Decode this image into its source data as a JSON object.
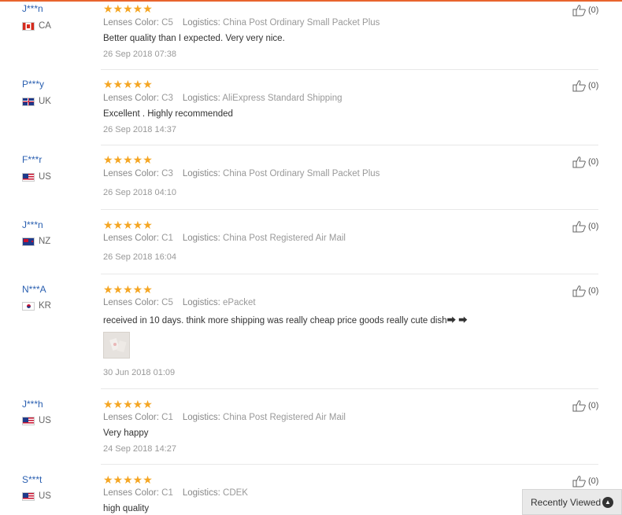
{
  "reviews": [
    {
      "name": "J***n",
      "country": "CA",
      "stars": "★★★★★",
      "color_key": "Lenses Color:",
      "color_val": "C5",
      "log_key": "Logistics:",
      "log_val": "China Post Ordinary Small Packet Plus",
      "text": "Better quality than I expected. Very very nice.",
      "date": "26 Sep 2018 07:38",
      "helpful": "(0)"
    },
    {
      "name": "P***y",
      "country": "UK",
      "stars": "★★★★★",
      "color_key": "Lenses Color:",
      "color_val": "C3",
      "log_key": "Logistics:",
      "log_val": "AliExpress Standard Shipping",
      "text": "Excellent . Highly recommended",
      "date": "26 Sep 2018 14:37",
      "helpful": "(0)"
    },
    {
      "name": "F***r",
      "country": "US",
      "stars": "★★★★★",
      "color_key": "Lenses Color:",
      "color_val": "C3",
      "log_key": "Logistics:",
      "log_val": "China Post Ordinary Small Packet Plus",
      "text": "",
      "date": "26 Sep 2018 04:10",
      "helpful": "(0)"
    },
    {
      "name": "J***n",
      "country": "NZ",
      "stars": "★★★★★",
      "color_key": "Lenses Color:",
      "color_val": "C1",
      "log_key": "Logistics:",
      "log_val": "China Post Registered Air Mail",
      "text": "",
      "date": "26 Sep 2018 16:04",
      "helpful": "(0)"
    },
    {
      "name": "N***A",
      "country": "KR",
      "stars": "★★★★★",
      "color_key": "Lenses Color:",
      "color_val": "C5",
      "log_key": "Logistics:",
      "log_val": "ePacket",
      "text": "received in 10 days. think more shipping was really cheap price goods really cute dish⮕ ⮕",
      "date": "30 Jun 2018 01:09",
      "helpful": "(0)"
    },
    {
      "name": "J***h",
      "country": "US",
      "stars": "★★★★★",
      "color_key": "Lenses Color:",
      "color_val": "C1",
      "log_key": "Logistics:",
      "log_val": "China Post Registered Air Mail",
      "text": "Very happy",
      "date": "24 Sep 2018 14:27",
      "helpful": "(0)"
    },
    {
      "name": "S***t",
      "country": "US",
      "stars": "★★★★★",
      "color_key": "Lenses Color:",
      "color_val": "C1",
      "log_key": "Logistics:",
      "log_val": "CDEK",
      "text": "high quality",
      "date": "",
      "helpful": "(0)"
    }
  ],
  "recently_viewed": {
    "label": "Recently Viewed",
    "icon": "chevron-up-icon"
  },
  "colors": {
    "accent": "#e8642d",
    "name": "#2a5fb0",
    "star": "#f5a623"
  }
}
